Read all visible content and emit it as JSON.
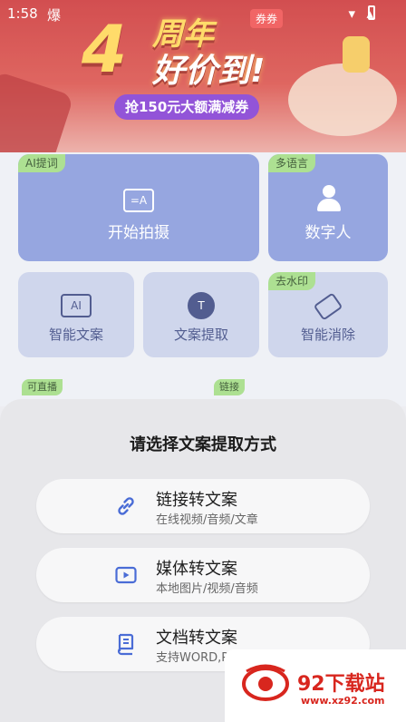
{
  "status_bar": {
    "time": "1:58",
    "extra_icon": "爆"
  },
  "banner": {
    "number": "4",
    "line1": "周年",
    "line2": "好价到!",
    "tagline": "抢150元大额满减券",
    "coupon": "券券"
  },
  "features": {
    "shoot": {
      "tag": "AI提词",
      "label": "开始拍摄",
      "icon": "=A"
    },
    "avatar": {
      "tag": "多语言",
      "label": "数字人",
      "icon_sub": "Ai"
    },
    "copywriting": {
      "label": "智能文案",
      "icon": "AI"
    },
    "extract": {
      "label": "文案提取",
      "icon": "T"
    },
    "erase": {
      "tag": "去水印",
      "label": "智能消除"
    }
  },
  "row3": {
    "tag_a": "可直播",
    "tag_b": "链接"
  },
  "sheet": {
    "title": "请选择文案提取方式",
    "options": [
      {
        "icon": "link-icon",
        "title": "链接转文案",
        "subtitle": "在线视频/音频/文章"
      },
      {
        "icon": "media-icon",
        "title": "媒体转文案",
        "subtitle": "本地图片/视频/音频"
      },
      {
        "icon": "document-icon",
        "title": "文档转文案",
        "subtitle": "支持WORD,PDF文档"
      }
    ]
  },
  "watermark": {
    "name": "92下载站",
    "url": "www.xz92.com"
  },
  "colors": {
    "accent_icon": "#4a6cd6",
    "banner_red": "#c9282a",
    "card_blue": "#7f93da"
  }
}
